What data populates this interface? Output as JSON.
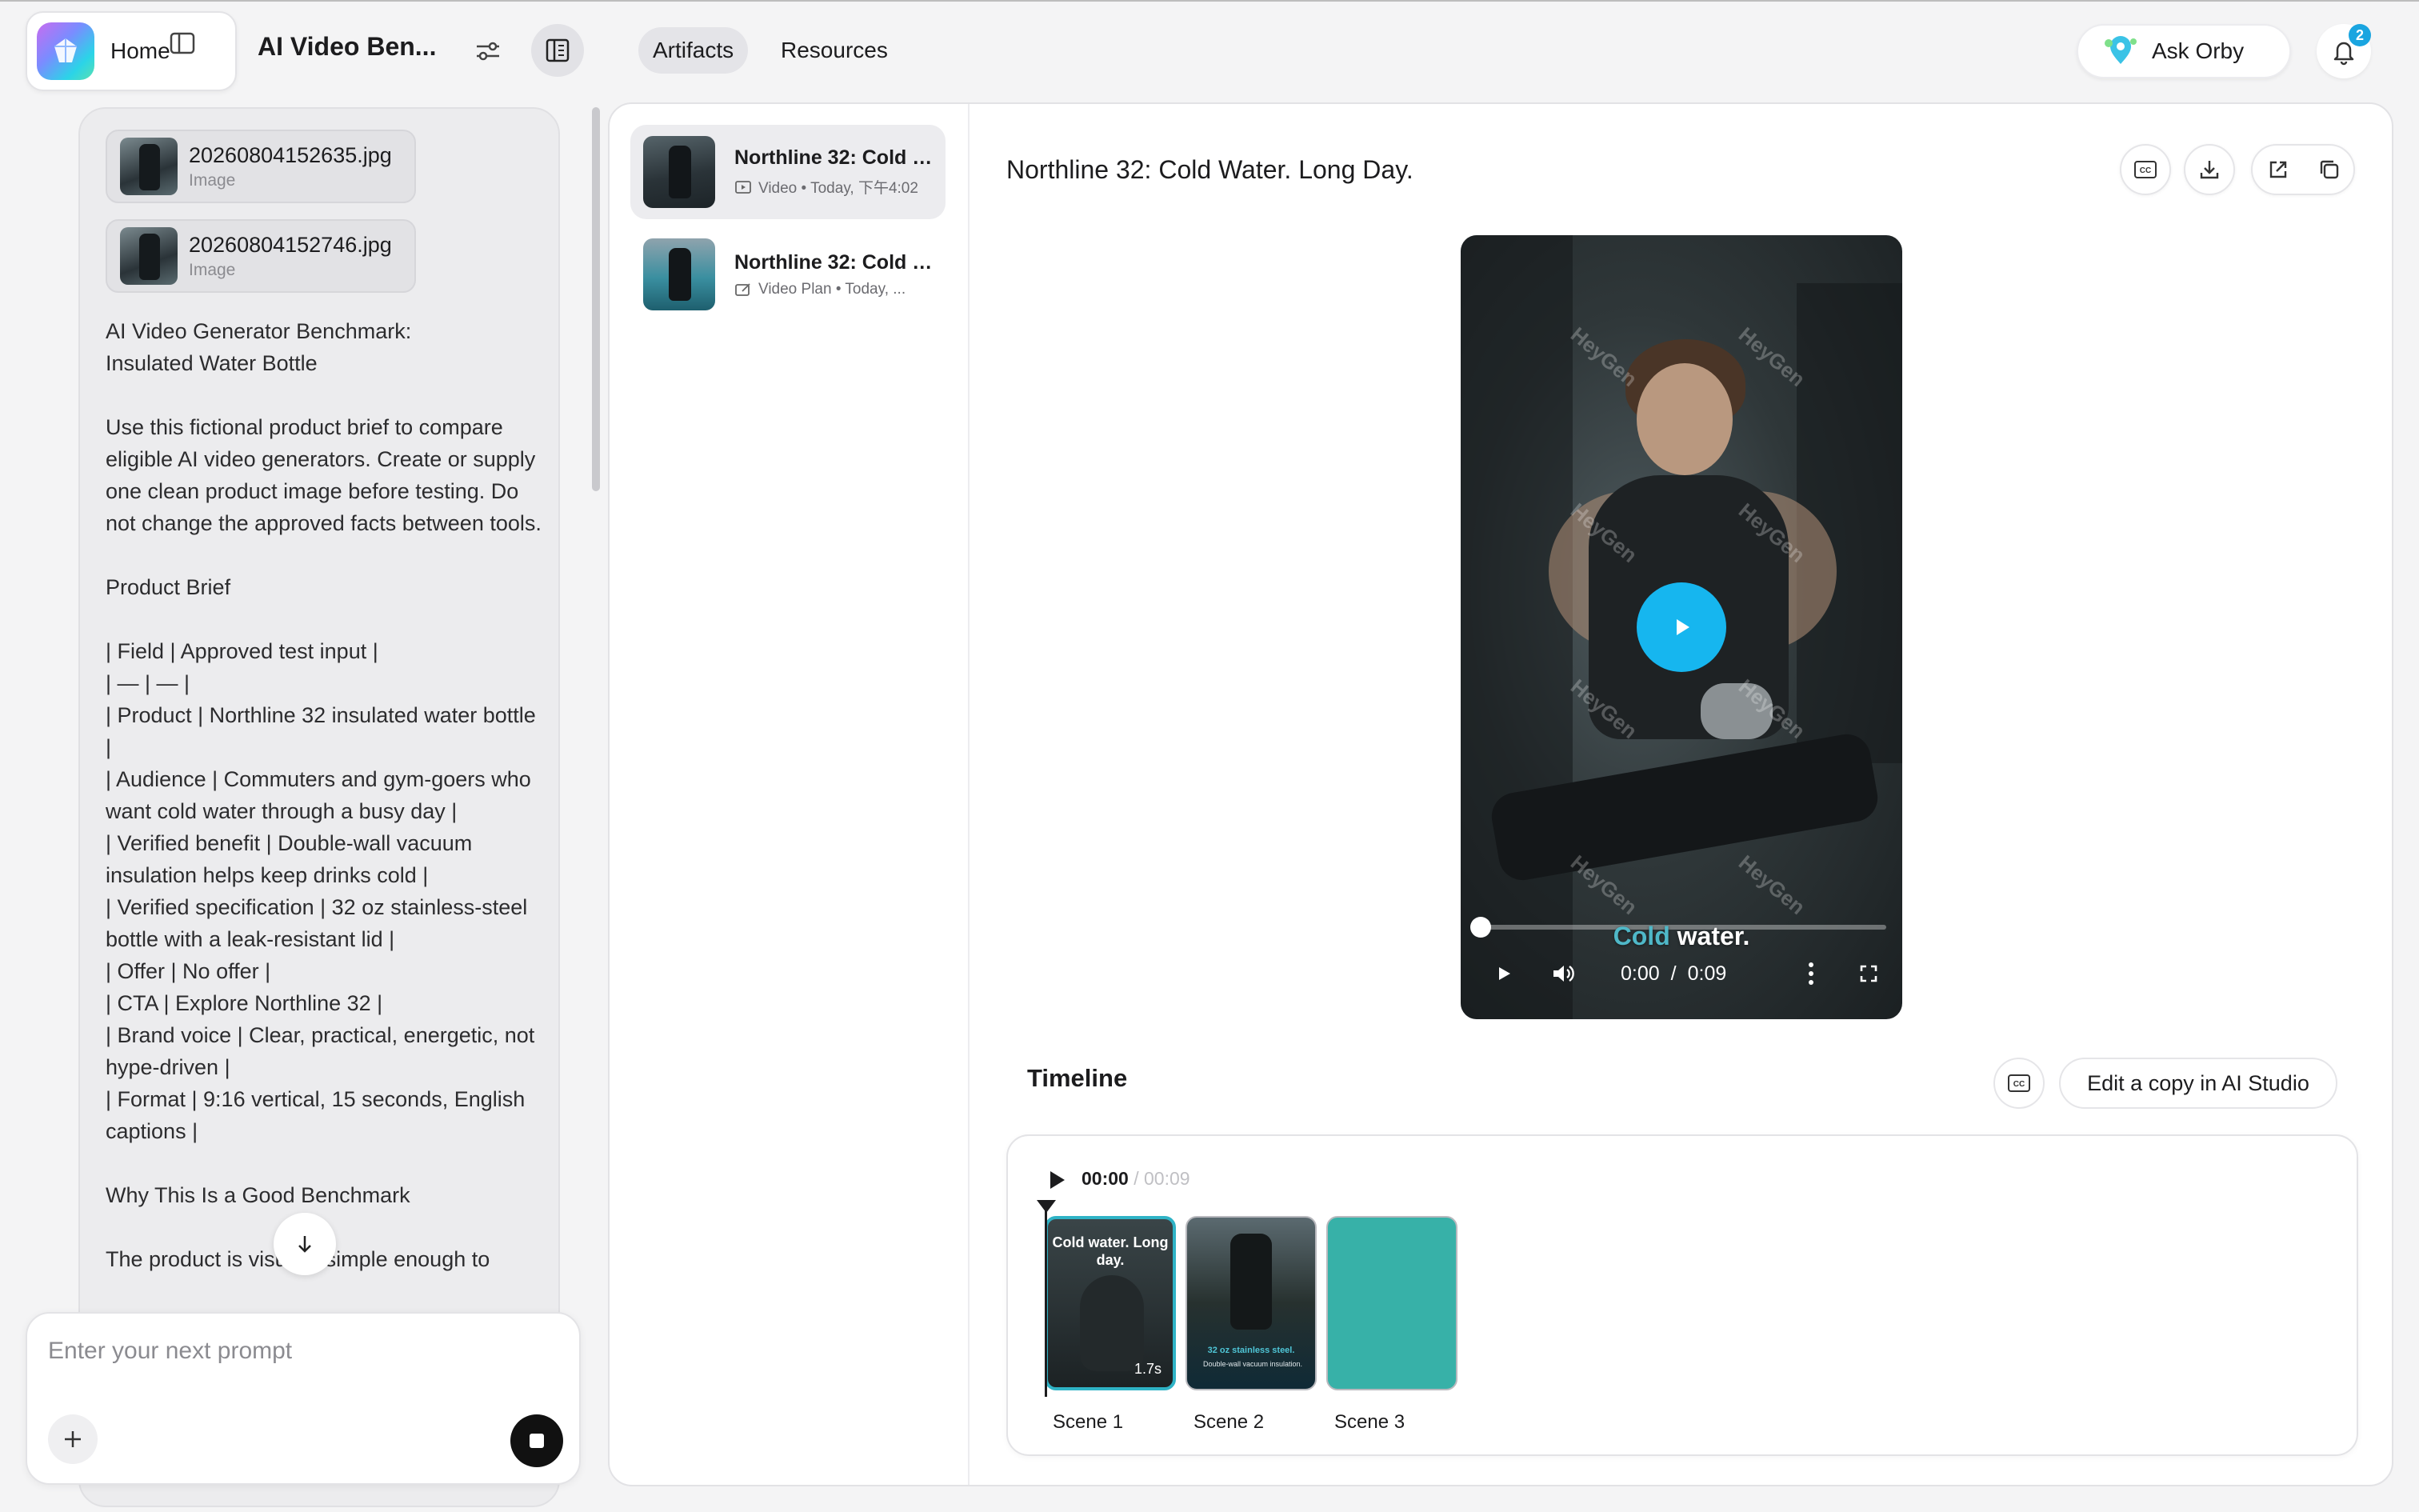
{
  "topbar": {
    "home_label": "Home",
    "project_title": "AI Video Ben...",
    "tabs": [
      {
        "label": "Artifacts",
        "active": true
      },
      {
        "label": "Resources",
        "active": false
      }
    ],
    "ask_orby_label": "Ask Orby",
    "notification_count": "2"
  },
  "chat": {
    "attachments": [
      {
        "name": "20260804152635.jpg",
        "type": "Image"
      },
      {
        "name": "20260804152746.jpg",
        "type": "Image"
      }
    ],
    "message_text": "AI Video Generator Benchmark:\nInsulated Water Bottle\n\nUse this fictional product brief to compare eligible AI video generators. Create or supply one clean product image before testing. Do not change the approved facts between tools.\n\nProduct Brief\n\n| Field | Approved test input |\n| — | — |\n| Product | Northline 32 insulated water bottle |\n| Audience | Commuters and gym-goers who want cold water through a busy day |\n| Verified benefit | Double-wall vacuum insulation helps keep drinks cold |\n| Verified specification | 32 oz stainless-steel bottle with a leak-resistant lid |\n| Offer | No offer |\n| CTA | Explore Northline 32 |\n| Brand voice | Clear, practical, energetic, not hype-driven |\n| Format | 9:16 vertical, 15 seconds, English captions |\n\nWhy This Is a Good Benchmark\n\nThe product is visually simple enough to"
  },
  "prompt": {
    "placeholder": "Enter your next prompt"
  },
  "artifacts": [
    {
      "title": "Northline 32: Cold Water. Long Day.",
      "kind": "Video",
      "time": "Today, 下午4:02",
      "subtitle": "Video • Today, 下午4:02",
      "active": true
    },
    {
      "title": "Northline 32: Cold Water. Long Day.",
      "kind": "Video Plan",
      "time": "Today, ...",
      "subtitle": "Video Plan • Today, ...",
      "active": false
    }
  ],
  "viewer": {
    "title": "Northline 32: Cold Water. Long Day.",
    "video": {
      "caption_highlight": "Cold",
      "caption_rest": " water.",
      "current_time": "0:00",
      "separator": "/",
      "duration": "0:09",
      "progress": 0,
      "watermark": "HeyGen"
    }
  },
  "timeline": {
    "title": "Timeline",
    "edit_copy_label": "Edit a copy in AI Studio",
    "current_time": "00:00",
    "total_time": " / 00:09",
    "scenes": [
      {
        "label": "Scene 1",
        "text": "Cold water. Long day.",
        "duration": "1.7s",
        "selected": true
      },
      {
        "label": "Scene 2",
        "caption": "32 oz stainless steel.",
        "subcaption": "Double-wall vacuum insulation."
      },
      {
        "label": "Scene 3"
      }
    ]
  },
  "colors": {
    "accent_blue": "#16b6ef",
    "scene_selected_border": "#2fb3c6",
    "scene3_fill": "#37b1a8",
    "badge_blue": "#1aa5e0"
  },
  "icons": {
    "sidebar_toggle": "sidebar-icon",
    "settings": "sliders-icon",
    "layout": "panel-layout-icon",
    "ask_orby": "orby-pin-icon",
    "notifications": "bell-icon",
    "scroll_down": "arrow-down-icon",
    "add": "plus-icon",
    "stop": "stop-icon",
    "captions": "cc-icon",
    "download": "download-icon",
    "open_external": "external-link-icon",
    "duplicate": "copy-icon"
  }
}
